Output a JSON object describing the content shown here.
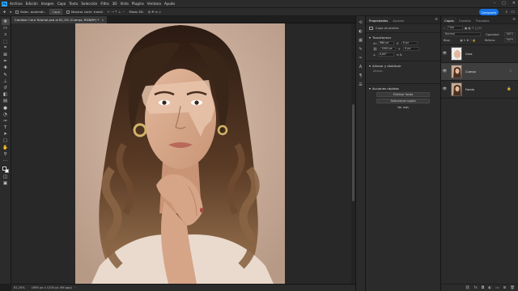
{
  "menu": {
    "app_icon": "Ps",
    "items": [
      "Archivo",
      "Edición",
      "Imagen",
      "Capa",
      "Texto",
      "Selección",
      "Filtro",
      "3D",
      "Vista",
      "Plugins",
      "Ventana",
      "Ayuda"
    ]
  },
  "options_bar": {
    "auto_select_label": "Selec. automát.:",
    "auto_select_value": "Capa",
    "transform_label": "Mostrar contr. transf.",
    "mode_3d": "Modo 3D:",
    "share_label": "Compartir"
  },
  "document": {
    "tab_title": "Cambiar Cara Tutorial.psd al 81,2% (Cuerpo, RGB/8*) *",
    "close_glyph": "×"
  },
  "status": {
    "zoom": "81,25%",
    "info": "1965 px x 1200 px (96 ppp)",
    "arrow": "›"
  },
  "properties": {
    "tabs": [
      "Propiedades",
      "Ajustes"
    ],
    "layer_type": "Capa de píxeles",
    "transform": {
      "title": "Transformar",
      "w_label": "An",
      "w_value": "960 px",
      "x_label": "X",
      "x_value": "0 px",
      "h_label": "Al",
      "h_value": "1200 px",
      "y_value": "0 px",
      "angle_value": "0,00°"
    },
    "align": {
      "title": "Alinear y distribuir",
      "sub": "Alinear:"
    },
    "quick_actions": {
      "title": "Acciones rápidas",
      "buttons": [
        "Eliminar fondo",
        "Seleccionar sujeto"
      ],
      "more": "Ver más"
    }
  },
  "layers": {
    "tabs": [
      "Capas",
      "Canales",
      "Trazados"
    ],
    "filter_label": "Tipo",
    "blend_label": "Normal",
    "opacity_label": "Opacidad:",
    "opacity_value": "100%",
    "lock_label": "Bloq.:",
    "fill_label": "Relleno:",
    "fill_value": "100%",
    "items": [
      {
        "name": "Cara",
        "visible": true,
        "active": false
      },
      {
        "name": "Cuerpo",
        "visible": true,
        "active": true
      },
      {
        "name": "Fondo",
        "visible": true,
        "active": false,
        "locked": true
      }
    ]
  }
}
